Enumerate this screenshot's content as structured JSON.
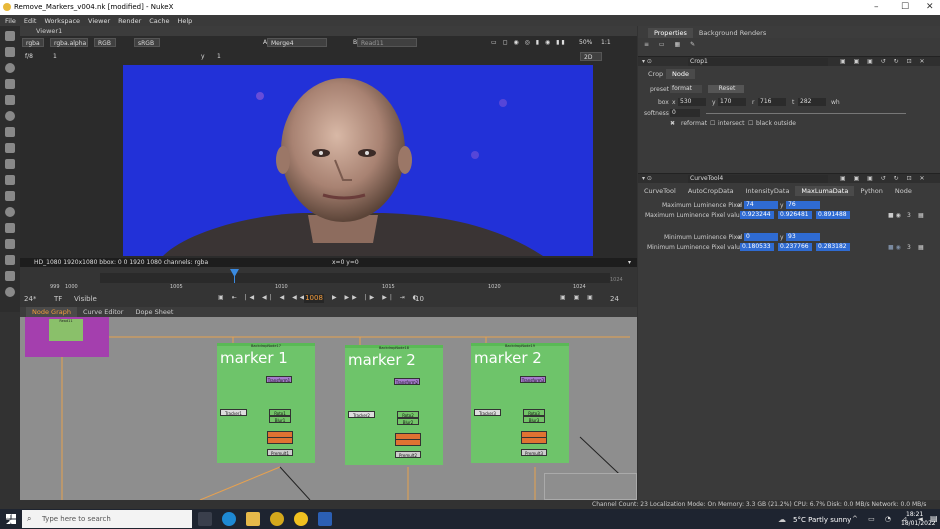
{
  "title": "Remove_Markers_v004.nk [modified] - NukeX",
  "window_controls": [
    "–",
    "☐",
    "✕"
  ],
  "menu": [
    "File",
    "Edit",
    "Workspace",
    "Viewer",
    "Render",
    "Cache",
    "Help"
  ],
  "viewer": {
    "tab": "Viewer1",
    "channels": "rgba",
    "alpha": "rgba.alpha",
    "colorspace": "RGB",
    "display": "sRGB",
    "input_a": "A",
    "input_a_node": "Merge4",
    "input_b": "B",
    "input_b_node": "Read11",
    "zoom": "50%",
    "proxy": "1:1",
    "view_mode": "2D",
    "frame_field": "f/8",
    "y_label": "y",
    "gain": "1",
    "gamma": "1",
    "info": "HD_1080 1920x1080  bbox: 0 0 1920 1080 channels: rgba",
    "coords": "x=0 y=0"
  },
  "timeline": {
    "ticks": [
      "1005",
      "1010",
      "1015",
      "1020",
      "1024"
    ],
    "left_marks": [
      "999",
      "1000"
    ],
    "fps": "24*",
    "tf": "TF",
    "visible": "Visible",
    "current_frame": "1008",
    "step": "10",
    "end_frame": "24",
    "end_label": "1024"
  },
  "node_graph": {
    "tabs": [
      "Node Graph",
      "Curve Editor",
      "Dope Sheet"
    ],
    "backdrops": [
      {
        "name": "BackdropNode17",
        "label": "marker 1"
      },
      {
        "name": "BackdropNode18",
        "label": "marker 2"
      },
      {
        "name": "BackdropNode19",
        "label": "marker 2"
      }
    ],
    "nodes": {
      "tracker1": "Tracker1",
      "tracker2": "Tracker2",
      "tracker3": "Tracker3",
      "transform1": "Transform1",
      "transform2": "Transform2",
      "transform3": "Transform3",
      "rotopaint1": "Roto1",
      "rotopaint2": "Roto2",
      "rotopaint3": "Roto3",
      "blur1": "Blur1",
      "blur2": "Blur2",
      "blur3": "Blur3",
      "premult1": "Premult1",
      "premult2": "Premult2",
      "premult3": "Premult3"
    },
    "read_label": "Read11"
  },
  "properties": {
    "tabs": [
      "Properties",
      "Background Renders"
    ],
    "crop": {
      "name": "Crop1",
      "tabs": [
        "Crop",
        "Node"
      ],
      "preset_label": "preset",
      "preset_value": "format",
      "reset": "Reset",
      "box_label": "box",
      "box": [
        {
          "k": "x",
          "v": "530"
        },
        {
          "k": "y",
          "v": "170"
        },
        {
          "k": "r",
          "v": "716"
        },
        {
          "k": "t",
          "v": "282"
        }
      ],
      "wh": "wh",
      "softness_label": "softness",
      "softness": "0",
      "reformat": "reformat",
      "intersect": "intersect",
      "black_outside": "black outside"
    },
    "curvetool": {
      "name": "CurveTool4",
      "tabs": [
        "CurveTool",
        "AutoCropData",
        "IntensityData",
        "MaxLumaData",
        "Python",
        "Node"
      ],
      "max_pixel_label": "Maximum Luminence Pixel",
      "max_pixel_x": "74",
      "max_pixel_y": "76",
      "max_value_label": "Maximum Luminence Pixel value",
      "max_values": [
        "0.923244",
        "0.926481",
        "0.891488"
      ],
      "min_pixel_label": "Minimum Luminence Pixel",
      "min_pixel_x": "0",
      "min_pixel_y": "93",
      "min_value_label": "Minimum Luminence Pixel value",
      "min_values": [
        "0.180533",
        "0.237766",
        "0.283182"
      ],
      "three": "3"
    }
  },
  "status": "Channel Count: 23  Localization Mode: On  Memory: 3.3 GB (21.2%)  CPU: 6.7%  Disk: 0.0 MB/s  Network: 0.0 MB/s",
  "taskbar": {
    "search_placeholder": "Type here to search",
    "weather": "5°C  Partly sunny",
    "time": "18:21",
    "date": "18/01/2022"
  },
  "colors": {
    "accent": "#f39c3c",
    "backdrop": "#6ec46a",
    "field_blue": "#2f6bd2",
    "viewer_bg": "#2231d8"
  }
}
